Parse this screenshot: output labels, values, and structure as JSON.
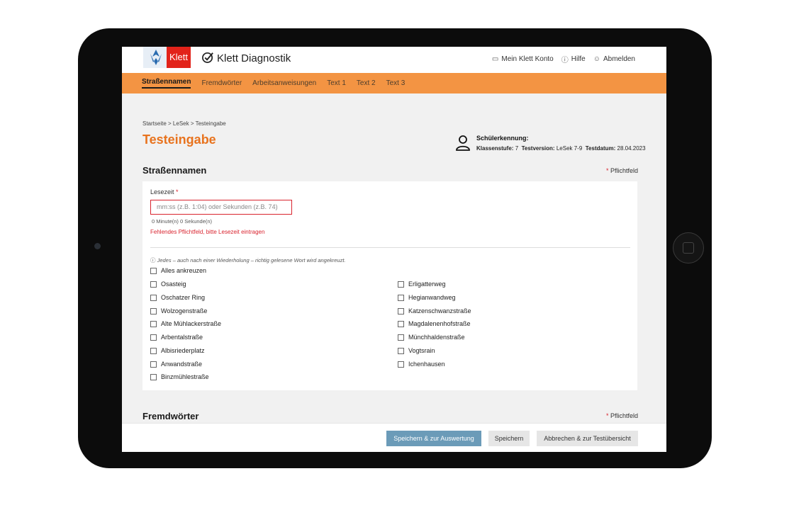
{
  "header": {
    "logo_text": "Klett",
    "app_title": "Klett Diagnostik",
    "nav": [
      {
        "label": "Mein Klett Konto",
        "icon": "account-icon"
      },
      {
        "label": "Hilfe",
        "icon": "help-icon"
      },
      {
        "label": "Abmelden",
        "icon": "user-icon"
      }
    ]
  },
  "tabs": [
    {
      "label": "Straßennamen",
      "active": true
    },
    {
      "label": "Fremdwörter",
      "active": false
    },
    {
      "label": "Arbeitsanweisungen",
      "active": false
    },
    {
      "label": "Text 1",
      "active": false
    },
    {
      "label": "Text 2",
      "active": false
    },
    {
      "label": "Text 3",
      "active": false
    }
  ],
  "breadcrumb": [
    "Startseite",
    "LeSek",
    "Testeingabe"
  ],
  "page_title": "Testeingabe",
  "student": {
    "heading": "Schülerkennung:",
    "klassenstufe_label": "Klassenstufe:",
    "klassenstufe": "7",
    "testversion_label": "Testversion:",
    "testversion": "LeSek 7-9",
    "testdatum_label": "Testdatum:",
    "testdatum": "28.04.2023"
  },
  "section1": {
    "title": "Straßennamen",
    "required": "Pflichtfeld",
    "lesezeit_label": "Lesezeit",
    "lesezeit_placeholder": "mm:ss (z.B. 1:04) oder Sekunden (z.B. 74)",
    "lesezeit_hint": "0 Minute(n) 0 Sekunde(n)",
    "lesezeit_error": "Fehlendes Pflichtfeld, bitte Lesezeit eintragen",
    "info": "Jedes – auch nach einer Wiederholung – richtig gelesene Wort wird angekreuzt.",
    "select_all": "Alles ankreuzen",
    "left_words": [
      "Osasteig",
      "Oschatzer Ring",
      "Wolzogenstraße",
      "Alte Mühlackerstraße",
      "Arbentalstraße",
      "Albisriederplatz",
      "Anwandstraße",
      "Binzmühlestraße"
    ],
    "right_words": [
      "Erligatterweg",
      "Hegianwandweg",
      "Katzenschwanzstraße",
      "Magdalenenhofstraße",
      "Münchhaldenstraße",
      "Vogtsrain",
      "Ichenhausen"
    ]
  },
  "section2": {
    "title": "Fremdwörter",
    "required": "Pflichtfeld"
  },
  "footer": {
    "primary": "Speichern & zur Auswertung",
    "save": "Speichern",
    "cancel": "Abbrechen & zur Testübersicht"
  },
  "colors": {
    "accent_orange": "#f39443",
    "title_orange": "#e8731e",
    "error_red": "#d9232e",
    "primary_button": "#6b9bb8"
  }
}
